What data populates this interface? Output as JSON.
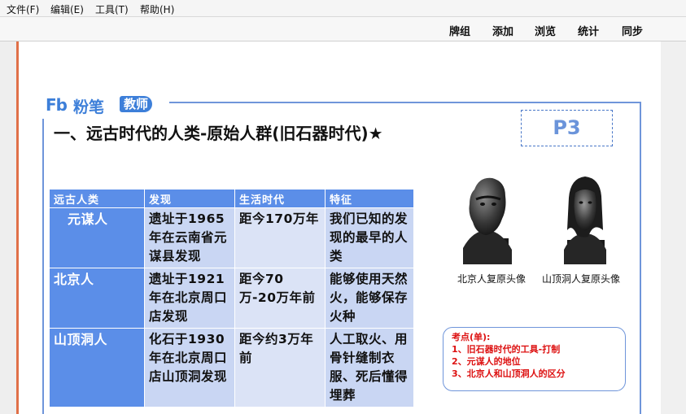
{
  "menu": [
    "文件(F)",
    "编辑(E)",
    "工具(T)",
    "帮助(H)"
  ],
  "toolbar": [
    "牌组",
    "添加",
    "浏览",
    "统计",
    "同步"
  ],
  "logo": {
    "mark": "Fb",
    "name": "粉笔",
    "badge": "教师"
  },
  "page_title": "一、远古时代的人类-原始人群(旧石器时代)★",
  "page_number": "P3",
  "table": {
    "headers": [
      "远古人类",
      "发现",
      "生活时代",
      "特征"
    ],
    "rows": [
      {
        "name": "元谋人",
        "discovery": "遗址于1965年在云南省元谋县发现",
        "era": "距今170万年",
        "feature": "我们已知的发现的最早的人类"
      },
      {
        "name": "北京人",
        "discovery": "遗址于1921年在北京周口店发现",
        "era": "距今70万-20万年前",
        "feature": "能够使用天然火，能够保存火种"
      },
      {
        "name": "山顶洞人",
        "discovery": "化石于1930年在北京周口店山顶洞发现",
        "era": "距今约3万年前",
        "feature": "人工取火、用骨针缝制衣服、死后懂得埋葬"
      }
    ]
  },
  "captions": [
    "北京人复原头像",
    "山顶洞人复原头像"
  ],
  "kaodian": {
    "title": "考点(单):",
    "items": [
      "1、旧石器时代的工具-打制",
      "2、元谋人的地位",
      "3、北京人和山顶洞人的区分"
    ]
  },
  "colors": {
    "accent": "#5b8ee8",
    "frame": "#6f95da",
    "cell_light": "#dbe3f6",
    "cell_mid": "#c9d6f3",
    "kaodian_text": "#dd1111",
    "page_edge": "#e07048"
  }
}
